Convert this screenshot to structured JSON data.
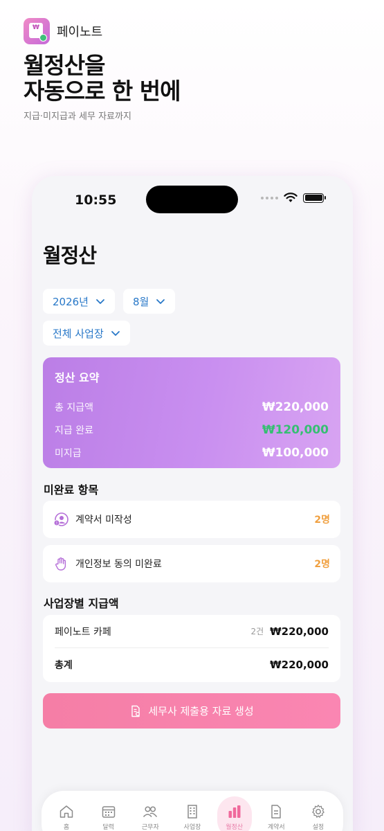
{
  "brand": {
    "name": "페이노트",
    "logo_mark": "₩"
  },
  "hero": {
    "title": "월정산을\n자동으로 한 번에",
    "subtitle": "지급·미지급과 세무 자료까지"
  },
  "status_bar": {
    "time": "10:55"
  },
  "page": {
    "title": "월정산"
  },
  "filters": {
    "year": "2026년",
    "month": "8월",
    "workplace": "전체 사업장"
  },
  "summary": {
    "title": "정산 요약",
    "rows": [
      {
        "label": "총 지급액",
        "value": "₩220,000"
      },
      {
        "label": "지급 완료",
        "value": "₩120,000"
      },
      {
        "label": "미지급",
        "value": "₩100,000"
      }
    ]
  },
  "incomplete": {
    "title": "미완료 항목",
    "items": [
      {
        "label": "계약서 미작성",
        "count": "2명",
        "icon": "contract-user-icon"
      },
      {
        "label": "개인정보 동의 미완료",
        "count": "2명",
        "icon": "hand-icon"
      }
    ]
  },
  "by_business": {
    "title": "사업장별 지급액",
    "rows": [
      {
        "name": "페이노트 카페",
        "count": "2건",
        "amount": "₩220,000"
      }
    ],
    "total": {
      "label": "총계",
      "amount": "₩220,000"
    }
  },
  "cta": {
    "label": "세무사 제출용 자료 생성"
  },
  "tabs": [
    {
      "label": "홈",
      "icon": "home-icon"
    },
    {
      "label": "달력",
      "icon": "calendar-icon"
    },
    {
      "label": "근무자",
      "icon": "workers-icon"
    },
    {
      "label": "사업장",
      "icon": "building-icon"
    },
    {
      "label": "월정산",
      "icon": "chart-bar-icon",
      "active": true
    },
    {
      "label": "계약서",
      "icon": "document-icon"
    },
    {
      "label": "설정",
      "icon": "gear-icon"
    }
  ],
  "colors": {
    "accent": "#f57ea6",
    "summary_gradient": "#c98ff0",
    "paid": "#35bf72",
    "count": "#f0a040",
    "link": "#2878c8"
  }
}
